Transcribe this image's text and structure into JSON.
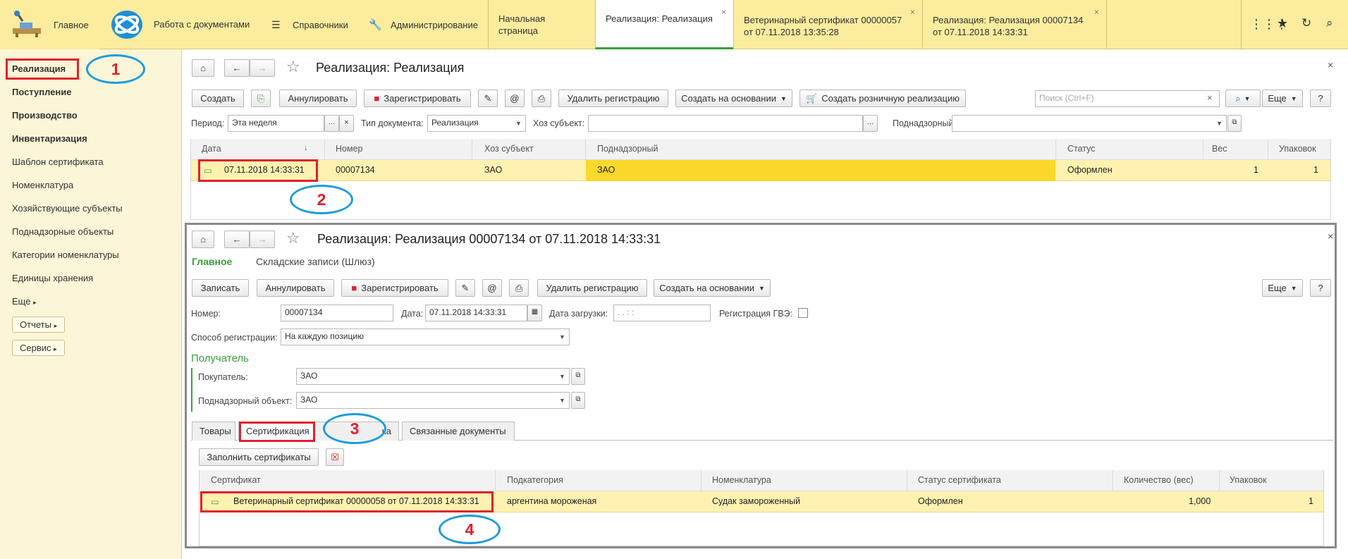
{
  "topbar": {
    "home_label": "Главное",
    "docs_label": "Работа с документами",
    "refs_label": "Справочники",
    "admin_label": "Администрирование",
    "tabs": [
      {
        "line1": "Начальная страница",
        "line2": ""
      },
      {
        "line1": "Реализация: Реализация",
        "line2": ""
      },
      {
        "line1": "Ветеринарный сертификат 00000057",
        "line2": "от 07.11.2018 13:35:28"
      },
      {
        "line1": "Реализация: Реализация 00007134",
        "line2": "от 07.11.2018 14:33:31"
      }
    ]
  },
  "sidebar": {
    "items": [
      "Реализация",
      "Поступление",
      "Производство",
      "Инвентаризация",
      "Шаблон сертификата",
      "Номенклатура",
      "Хозяйствующие субъекты",
      "Поднадзорные объекты",
      "Категории номенклатуры",
      "Единицы хранения",
      "Еще"
    ],
    "reports_label": "Отчеты",
    "service_label": "Сервис"
  },
  "list": {
    "title": "Реализация: Реализация",
    "btn_create": "Создать",
    "btn_annul": "Аннулировать",
    "btn_register": "Зарегистрировать",
    "btn_delete_reg": "Удалить регистрацию",
    "btn_create_based": "Создать на основании",
    "btn_create_retail": "Создать розничную реализацию",
    "search_placeholder": "Поиск (Ctrl+F)",
    "btn_more": "Еще",
    "btn_help": "?",
    "filter_period_label": "Период:",
    "filter_period_value": "Эта неделя",
    "filter_doctype_label": "Тип документа:",
    "filter_doctype_value": "Реализация",
    "filter_subject_label": "Хоз субъект:",
    "filter_supervised_label": "Поднадзорный:",
    "columns": [
      "Дата",
      "Номер",
      "Хоз субъект",
      "Поднадзорный",
      "Статус",
      "Вес",
      "Упаковок"
    ],
    "row": {
      "date": "07.11.2018 14:33:31",
      "number": "00007134",
      "subject": "ЗАО",
      "supervised": "ЗАО",
      "status": "Оформлен",
      "weight": "1",
      "packs": "1"
    }
  },
  "doc": {
    "title": "Реализация: Реализация 00007134 от 07.11.2018 14:33:31",
    "tab_main": "Главное",
    "tab_warehouse": "Складские записи (Шлюз)",
    "btn_save": "Записать",
    "btn_annul": "Аннулировать",
    "btn_register": "Зарегистрировать",
    "btn_delete_reg": "Удалить регистрацию",
    "btn_create_based": "Создать на основании",
    "btn_more": "Еще",
    "btn_help": "?",
    "number_label": "Номер:",
    "number_value": "00007134",
    "date_label": "Дата:",
    "date_value": "07.11.2018 14:33:31",
    "load_date_label": "Дата загрузки:",
    "load_date_value": " .  .     :  :",
    "gvz_label": "Регистрация ГВЭ:",
    "method_label": "Способ регистрации:",
    "method_value": "На каждую позицию",
    "recipient_label": "Получатель",
    "buyer_label": "Покупатель:",
    "buyer_value": "ЗАО",
    "object_label": "Поднадзорный объект:",
    "object_value": "ЗАО",
    "tabs": [
      "Товары",
      "Сертификация",
      "ка",
      "Связанные документы"
    ],
    "btn_fill_certs": "Заполнить сертификаты",
    "cert_columns": [
      "Сертификат",
      "Подкатегория",
      "Номенклатура",
      "Статус сертификата",
      "Количество (вес)",
      "Упаковок"
    ],
    "cert_row": {
      "cert": "Ветеринарный сертификат 00000058 от 07.11.2018 14:33:31",
      "subcat": "аргентина мороженая",
      "nomen": "Судак замороженный",
      "status": "Оформлен",
      "qty": "1,000",
      "packs": "1"
    }
  },
  "annotations": [
    "1",
    "2",
    "3",
    "4"
  ],
  "colors": {
    "topbar": "#fbec9e",
    "sidebar": "#fbf6d7",
    "row_highlight": "#fff2b0",
    "row_selected": "#fbd82a",
    "annotation_red": "#e0202c",
    "annotation_blue": "#1e9be0",
    "green_accent": "#3a9e3a"
  }
}
